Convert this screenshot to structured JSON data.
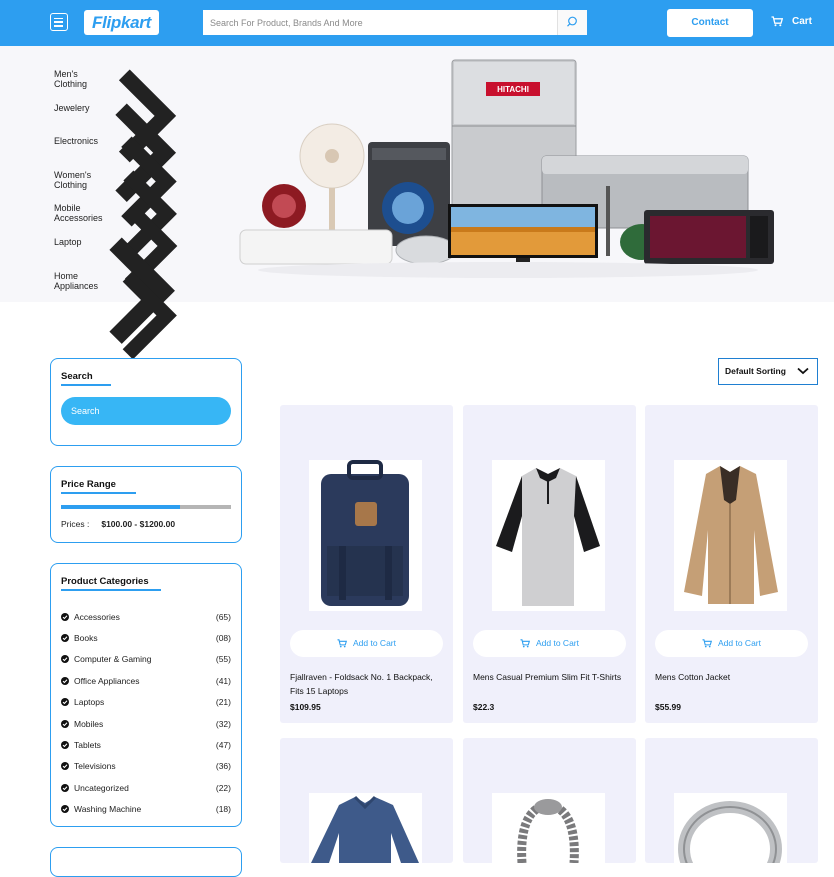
{
  "header": {
    "logo": "Flipkart",
    "search_placeholder": "Search For Product, Brands And More",
    "contact_label": "Contact",
    "cart_label": "Cart"
  },
  "hero": {
    "categories": [
      "Men's Clothing",
      "Jewelery",
      "Electronics",
      "Women's Clothing",
      "Mobile Accessories",
      "Laptop",
      "Home Appliances"
    ],
    "banner_brand": "HITACHI"
  },
  "sidebar": {
    "search": {
      "title": "Search",
      "button_label": "Search"
    },
    "price_range": {
      "title": "Price Range",
      "prices_label": "Prices :",
      "range_text": "$100.00 - $1200.00",
      "fill_fraction": 0.7
    },
    "product_categories": {
      "title": "Product Categories",
      "items": [
        {
          "name": "Accessories",
          "count": "(65)"
        },
        {
          "name": "Books",
          "count": "(08)"
        },
        {
          "name": "Computer & Gaming",
          "count": "(55)"
        },
        {
          "name": "Office Appliances",
          "count": "(41)"
        },
        {
          "name": "Laptops",
          "count": "(21)"
        },
        {
          "name": "Mobiles",
          "count": "(32)"
        },
        {
          "name": "Tablets",
          "count": "(47)"
        },
        {
          "name": "Televisions",
          "count": "(36)"
        },
        {
          "name": "Uncategorized",
          "count": "(22)"
        },
        {
          "name": "Washing Machine",
          "count": "(18)"
        }
      ]
    }
  },
  "sorting": {
    "selected": "Default Sorting"
  },
  "products": {
    "add_to_cart_label": "Add to Cart",
    "items": [
      {
        "name": "Fjallraven - Foldsack No. 1 Backpack, Fits 15 Laptops",
        "price": "$109.95"
      },
      {
        "name": "Mens Casual Premium Slim Fit T-Shirts",
        "price": "$22.3"
      },
      {
        "name": "Mens Cotton Jacket",
        "price": "$55.99"
      }
    ]
  },
  "colors": {
    "primary": "#2d9ef0",
    "card_bg": "#f0f0fb"
  }
}
